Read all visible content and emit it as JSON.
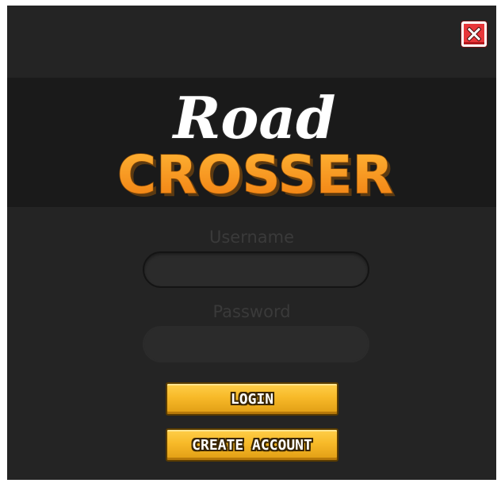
{
  "logo": {
    "word_top": "Road",
    "word_bottom": "CROSSER",
    "word_top_color": "#ffffff",
    "word_bottom_color": "#f7941d"
  },
  "close_icon": "close-x-icon",
  "form": {
    "username_label": "Username",
    "username_value": "",
    "password_label": "Password",
    "password_value": ""
  },
  "buttons": {
    "login_label": "LOGIN",
    "create_account_label": "CREATE ACCOUNT"
  },
  "colors": {
    "background": "#242424",
    "banner": "#1a1a1a",
    "button_gold": "#f7b928",
    "close_red": "#e8363a"
  }
}
